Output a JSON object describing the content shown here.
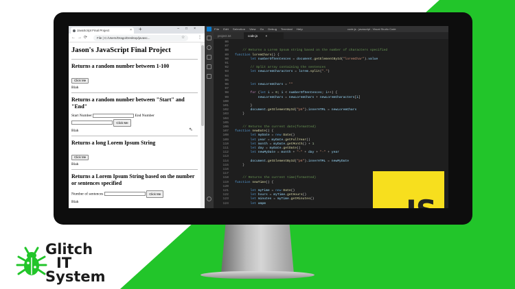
{
  "colors": {
    "green": "#22c52a",
    "js_yellow": "#f7df1e",
    "vscode_bg": "#1e1e1e"
  },
  "chrome": {
    "tab_title": "JavaScript Final Project",
    "url": "File | C:/Users/Drago/Desktop/javasc...",
    "new_tab_icon": "plus-icon"
  },
  "page": {
    "title": "Jason's JavaScript Final Project",
    "sections": [
      {
        "heading": "Returns a random number between 1-100",
        "button": "Click Me",
        "output": "Blah"
      },
      {
        "heading": "Returns a random number between \"Start\" and \"End\"",
        "start_label": "Start Number",
        "end_label": "End Number",
        "button": "Click Me",
        "output": "Blah"
      },
      {
        "heading": "Returns a long Lorem Ipsum String",
        "button": "Click Me",
        "output": "Blah"
      },
      {
        "heading": "Returns a Lorem Ipsum String based on the number or sentences specified",
        "sentences_label": "Number of sentences",
        "button": "Click Me",
        "output": "Blah"
      }
    ]
  },
  "vscode": {
    "menu": [
      "File",
      "Edit",
      "Selection",
      "View",
      "Go",
      "Debug",
      "Terminal",
      "Help"
    ],
    "window_title": "code.js - javascript - Visual Studio Code",
    "tabs": [
      "project.txt",
      "code.js"
    ],
    "lines": [
      {
        "n": "86",
        "segs": []
      },
      {
        "n": "87",
        "segs": []
      },
      {
        "n": "88",
        "segs": [
          [
            "c-com",
            "    // Returns a Lorem Ipsum string based on the number of characters specified"
          ]
        ]
      },
      {
        "n": "89",
        "segs": [
          [
            "c-kw",
            "function "
          ],
          [
            "c-fn",
            "loremChars"
          ],
          [
            "c-pl",
            "() {"
          ]
        ]
      },
      {
        "n": "90",
        "segs": [
          [
            "c-kw",
            "        let "
          ],
          [
            "c-var",
            "numberOfSentences"
          ],
          [
            "c-pl",
            " = "
          ],
          [
            "c-var",
            "document"
          ],
          [
            "c-pl",
            "."
          ],
          [
            "c-fn",
            "getElementById"
          ],
          [
            "c-pl",
            "("
          ],
          [
            "c-str",
            "\"loremChar\""
          ],
          [
            "c-pl",
            ")."
          ],
          [
            "c-var",
            "value"
          ]
        ]
      },
      {
        "n": "91",
        "segs": []
      },
      {
        "n": "92",
        "segs": [
          [
            "c-com",
            "        // Split array containing the sentences"
          ]
        ]
      },
      {
        "n": "93",
        "segs": [
          [
            "c-kw",
            "        let "
          ],
          [
            "c-var",
            "newLoremCharacters"
          ],
          [
            "c-pl",
            " = "
          ],
          [
            "c-var",
            "lorem"
          ],
          [
            "c-pl",
            "."
          ],
          [
            "c-fn",
            "split"
          ],
          [
            "c-pl",
            "("
          ],
          [
            "c-str",
            "\".\""
          ],
          [
            "c-pl",
            ")"
          ]
        ]
      },
      {
        "n": "94",
        "segs": []
      },
      {
        "n": "95",
        "segs": []
      },
      {
        "n": "96",
        "segs": [
          [
            "c-kw",
            "        let "
          ],
          [
            "c-var",
            "newLoremChars"
          ],
          [
            "c-pl",
            " = "
          ],
          [
            "c-str",
            "\"\""
          ]
        ]
      },
      {
        "n": "97",
        "segs": []
      },
      {
        "n": "98",
        "segs": [
          [
            "c-ctl",
            "        for "
          ],
          [
            "c-pl",
            "("
          ],
          [
            "c-kw",
            "let "
          ],
          [
            "c-var",
            "i"
          ],
          [
            "c-pl",
            " = "
          ],
          [
            "c-num",
            "0"
          ],
          [
            "c-pl",
            "; "
          ],
          [
            "c-var",
            "i"
          ],
          [
            "c-pl",
            " < "
          ],
          [
            "c-var",
            "numberOfSentences"
          ],
          [
            "c-pl",
            "; "
          ],
          [
            "c-var",
            "i"
          ],
          [
            "c-pl",
            "++) {"
          ]
        ]
      },
      {
        "n": "99",
        "segs": [
          [
            "c-var",
            "            newLoremChars"
          ],
          [
            "c-pl",
            " = "
          ],
          [
            "c-var",
            "newLoremChars"
          ],
          [
            "c-pl",
            " + "
          ],
          [
            "c-var",
            "newLoremCharacters"
          ],
          [
            "c-pl",
            "["
          ],
          [
            "c-var",
            "i"
          ],
          [
            "c-pl",
            "]"
          ]
        ]
      },
      {
        "n": "100",
        "segs": []
      },
      {
        "n": "101",
        "segs": [
          [
            "c-pl",
            "        }"
          ]
        ]
      },
      {
        "n": "102",
        "segs": [
          [
            "c-var",
            "        document"
          ],
          [
            "c-pl",
            "."
          ],
          [
            "c-fn",
            "getElementById"
          ],
          [
            "c-pl",
            "("
          ],
          [
            "c-str",
            "\"p5\""
          ],
          [
            "c-pl",
            ")."
          ],
          [
            "c-var",
            "innerHTML"
          ],
          [
            "c-pl",
            " = "
          ],
          [
            "c-var",
            "newLoremChars"
          ]
        ]
      },
      {
        "n": "103",
        "segs": [
          [
            "c-pl",
            "    }"
          ]
        ]
      },
      {
        "n": "104",
        "segs": []
      },
      {
        "n": "105",
        "segs": []
      },
      {
        "n": "106",
        "segs": [
          [
            "c-com",
            "    // Returns the current date(formatted)"
          ]
        ]
      },
      {
        "n": "107",
        "segs": [
          [
            "c-kw",
            "function "
          ],
          [
            "c-fn",
            "newDate"
          ],
          [
            "c-pl",
            "() {"
          ]
        ]
      },
      {
        "n": "108",
        "segs": [
          [
            "c-kw",
            "        let "
          ],
          [
            "c-var",
            "myDate"
          ],
          [
            "c-pl",
            " = "
          ],
          [
            "c-kw",
            "new "
          ],
          [
            "c-fn",
            "Date"
          ],
          [
            "c-pl",
            "()"
          ]
        ]
      },
      {
        "n": "109",
        "segs": [
          [
            "c-kw",
            "        let "
          ],
          [
            "c-var",
            "year"
          ],
          [
            "c-pl",
            " = "
          ],
          [
            "c-var",
            "myDate"
          ],
          [
            "c-pl",
            "."
          ],
          [
            "c-fn",
            "getFullYear"
          ],
          [
            "c-pl",
            "()"
          ]
        ]
      },
      {
        "n": "110",
        "segs": [
          [
            "c-kw",
            "        let "
          ],
          [
            "c-var",
            "month"
          ],
          [
            "c-pl",
            " = "
          ],
          [
            "c-var",
            "myDate"
          ],
          [
            "c-pl",
            "."
          ],
          [
            "c-fn",
            "getMonth"
          ],
          [
            "c-pl",
            "() + "
          ],
          [
            "c-num",
            "1"
          ]
        ]
      },
      {
        "n": "111",
        "segs": [
          [
            "c-kw",
            "        let "
          ],
          [
            "c-var",
            "day"
          ],
          [
            "c-pl",
            " = "
          ],
          [
            "c-var",
            "myDate"
          ],
          [
            "c-pl",
            "."
          ],
          [
            "c-fn",
            "getDate"
          ],
          [
            "c-pl",
            "()"
          ]
        ]
      },
      {
        "n": "112",
        "segs": [
          [
            "c-kw",
            "        let "
          ],
          [
            "c-var",
            "newMyDate"
          ],
          [
            "c-pl",
            " = "
          ],
          [
            "c-var",
            "month"
          ],
          [
            "c-pl",
            " + "
          ],
          [
            "c-str",
            "\"-\""
          ],
          [
            "c-pl",
            " + "
          ],
          [
            "c-var",
            "day"
          ],
          [
            "c-pl",
            " + "
          ],
          [
            "c-str",
            "\"-\""
          ],
          [
            "c-pl",
            " + "
          ],
          [
            "c-var",
            "year"
          ]
        ]
      },
      {
        "n": "113",
        "segs": []
      },
      {
        "n": "114",
        "segs": [
          [
            "c-var",
            "        document"
          ],
          [
            "c-pl",
            "."
          ],
          [
            "c-fn",
            "getElementById"
          ],
          [
            "c-pl",
            "("
          ],
          [
            "c-str",
            "\"p6\""
          ],
          [
            "c-pl",
            ")."
          ],
          [
            "c-var",
            "innerHTML"
          ],
          [
            "c-pl",
            " = "
          ],
          [
            "c-var",
            "newMyDate"
          ]
        ]
      },
      {
        "n": "115",
        "segs": [
          [
            "c-pl",
            "    }"
          ]
        ]
      },
      {
        "n": "116",
        "segs": []
      },
      {
        "n": "117",
        "segs": []
      },
      {
        "n": "118",
        "segs": [
          [
            "c-com",
            "    // Returns the current time(formatted)"
          ]
        ]
      },
      {
        "n": "119",
        "segs": [
          [
            "c-kw",
            "function "
          ],
          [
            "c-fn",
            "newTime"
          ],
          [
            "c-pl",
            "() {"
          ]
        ]
      },
      {
        "n": "120",
        "segs": []
      },
      {
        "n": "121",
        "segs": [
          [
            "c-kw",
            "        let "
          ],
          [
            "c-var",
            "myTime"
          ],
          [
            "c-pl",
            " = "
          ],
          [
            "c-kw",
            "new "
          ],
          [
            "c-fn",
            "Date"
          ],
          [
            "c-pl",
            "()"
          ]
        ]
      },
      {
        "n": "122",
        "segs": [
          [
            "c-kw",
            "        let "
          ],
          [
            "c-var",
            "hours"
          ],
          [
            "c-pl",
            " = "
          ],
          [
            "c-var",
            "myTime"
          ],
          [
            "c-pl",
            "."
          ],
          [
            "c-fn",
            "getHours"
          ],
          [
            "c-pl",
            "()"
          ]
        ]
      },
      {
        "n": "123",
        "segs": [
          [
            "c-kw",
            "        let "
          ],
          [
            "c-var",
            "minutes"
          ],
          [
            "c-pl",
            " = "
          ],
          [
            "c-var",
            "myTime"
          ],
          [
            "c-pl",
            "."
          ],
          [
            "c-fn",
            "getMinutes"
          ],
          [
            "c-pl",
            "()"
          ]
        ]
      },
      {
        "n": "124",
        "segs": [
          [
            "c-kw",
            "        let "
          ],
          [
            "c-var",
            "ampm"
          ]
        ]
      }
    ]
  },
  "js_logo": {
    "text": "JS"
  },
  "brand": {
    "line1": "Glitch",
    "line2": "IT",
    "line3": "System",
    "icon": "bug-icon"
  }
}
